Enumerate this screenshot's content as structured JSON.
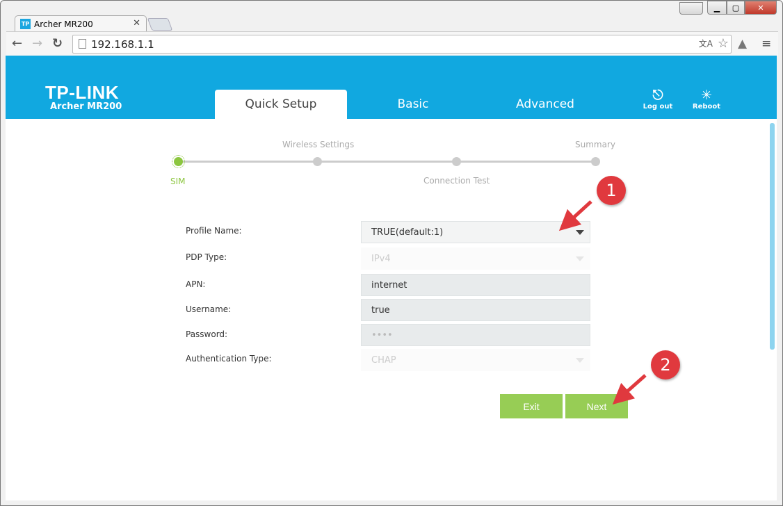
{
  "browser": {
    "tab_title": "Archer MR200",
    "favicon_text": "TP",
    "url": "192.168.1.1"
  },
  "header": {
    "logo": "TP-LINK",
    "model": "Archer MR200",
    "tabs": [
      {
        "label": "Quick Setup",
        "active": true
      },
      {
        "label": "Basic"
      },
      {
        "label": "Advanced"
      }
    ],
    "logout": "Log out",
    "reboot": "Reboot",
    "color": "#11a8e0"
  },
  "wizard": {
    "steps": [
      "SIM",
      "Wireless Settings",
      "Connection Test",
      "Summary"
    ],
    "current": "SIM",
    "accent": "#8cc63f"
  },
  "form": {
    "profile_name": {
      "label": "Profile Name:",
      "value": "TRUE(default:1)"
    },
    "pdp_type": {
      "label": "PDP Type:",
      "value": "IPv4"
    },
    "apn": {
      "label": "APN:",
      "value": "internet"
    },
    "username": {
      "label": "Username:",
      "value": "true"
    },
    "password": {
      "label": "Password:",
      "value": "••••"
    },
    "auth_type": {
      "label": "Authentication Type:",
      "value": "CHAP"
    }
  },
  "buttons": {
    "exit": "Exit",
    "next": "Next"
  },
  "annotations": {
    "first": "1",
    "second": "2",
    "color": "#e0393e"
  }
}
